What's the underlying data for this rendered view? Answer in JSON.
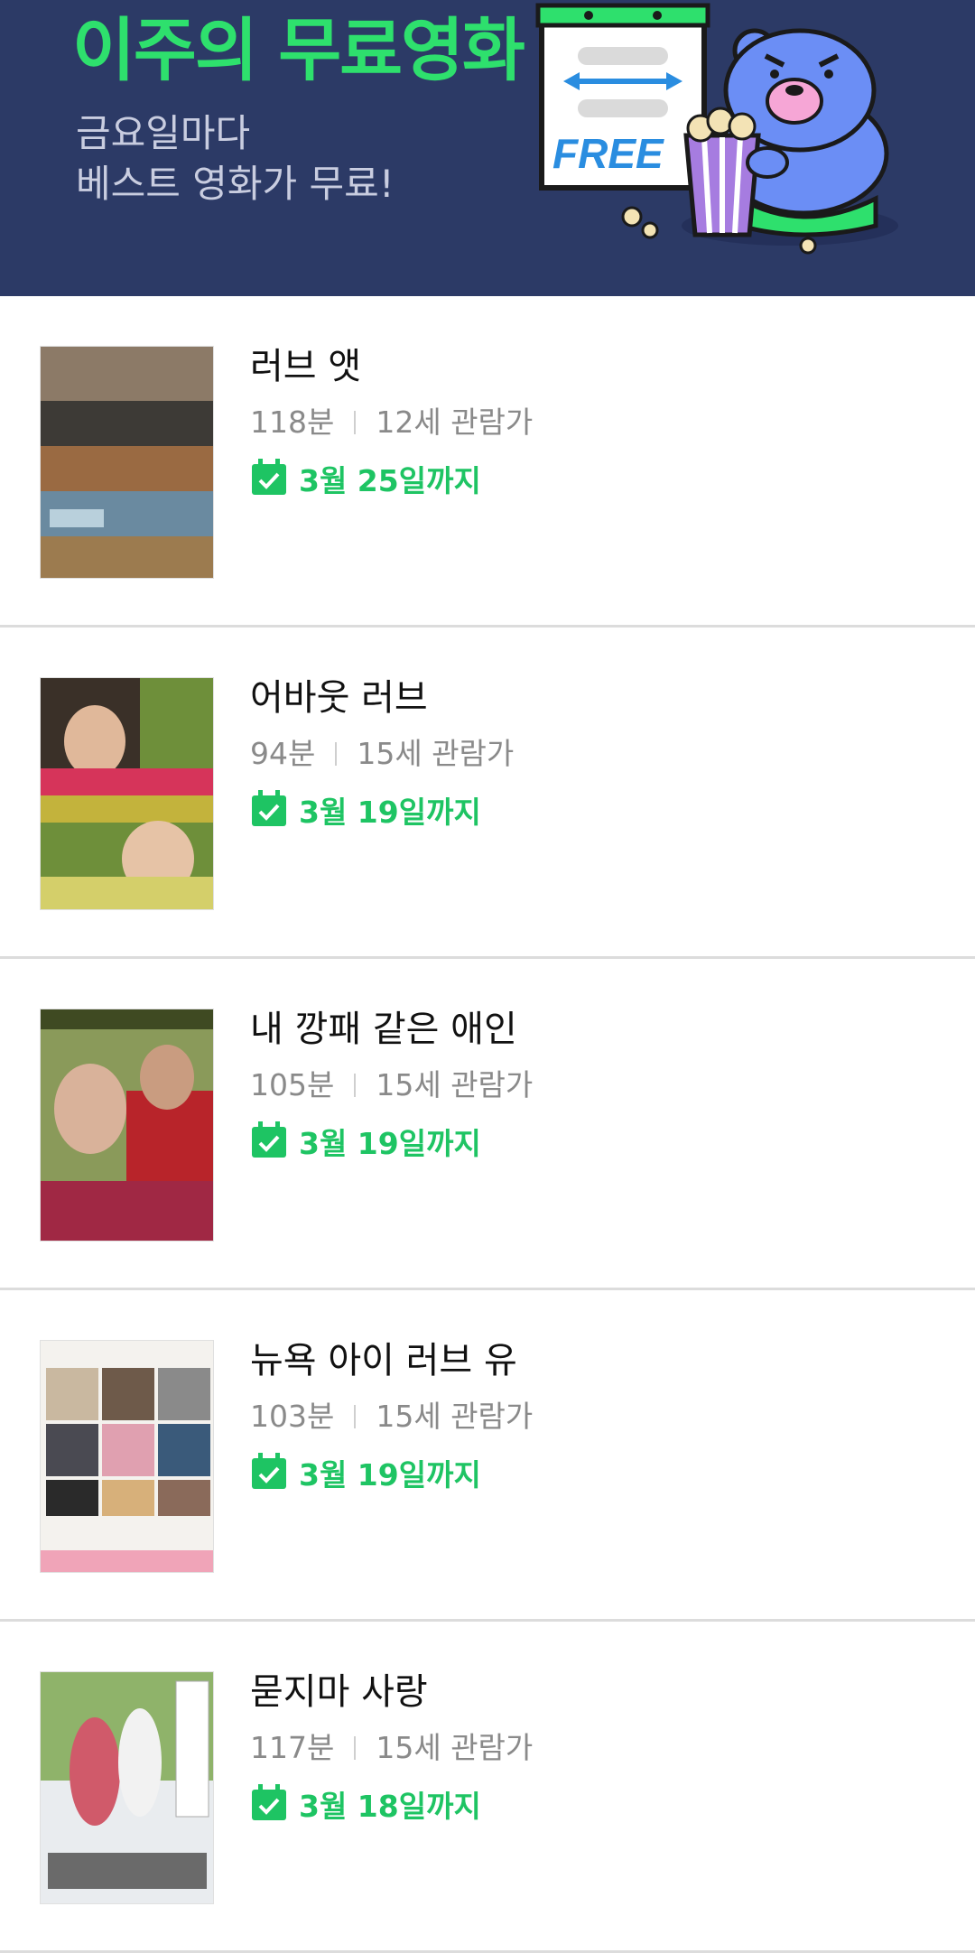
{
  "banner": {
    "title": "이주의 무료영화",
    "subtitle_line1": "금요일마다",
    "subtitle_line2": "베스트 영화가 무료!",
    "sign_text": "FREE"
  },
  "colors": {
    "banner_bg": "#2c3a66",
    "accent_green": "#1ec463",
    "title_green": "#2ee06d"
  },
  "movies": [
    {
      "title": "러브 앳",
      "runtime": "118분",
      "rating": "12세 관람가",
      "deadline": "3월 25일까지"
    },
    {
      "title": "어바웃 러브",
      "runtime": "94분",
      "rating": "15세 관람가",
      "deadline": "3월 19일까지"
    },
    {
      "title": "내 깡패 같은 애인",
      "runtime": "105분",
      "rating": "15세 관람가",
      "deadline": "3월 19일까지"
    },
    {
      "title": "뉴욕 아이 러브 유",
      "runtime": "103분",
      "rating": "15세 관람가",
      "deadline": "3월 19일까지"
    },
    {
      "title": "묻지마 사랑",
      "runtime": "117분",
      "rating": "15세 관람가",
      "deadline": "3월 18일까지"
    }
  ]
}
